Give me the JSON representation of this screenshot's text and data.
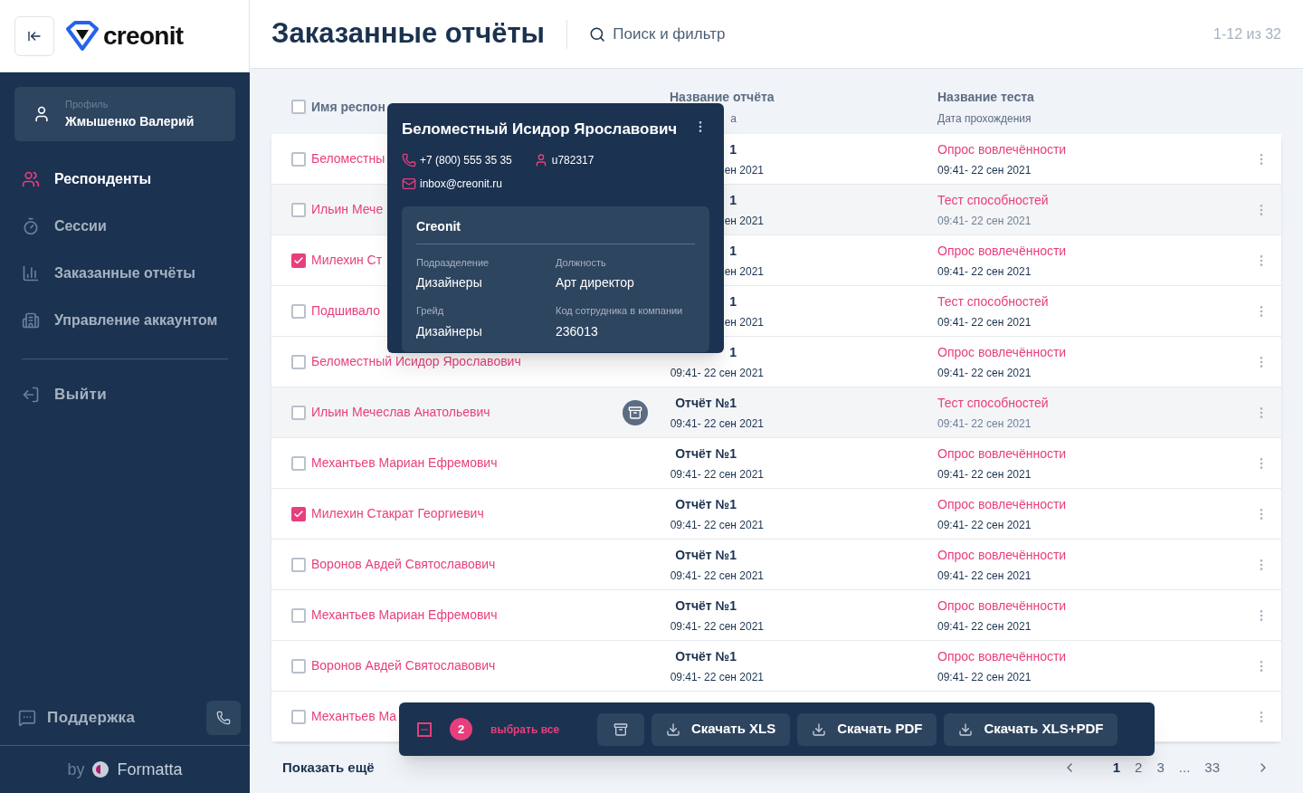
{
  "brand": {
    "name": "creonit"
  },
  "sidebar": {
    "profile": {
      "label": "Профиль",
      "name": "Жмышенко Валерий"
    },
    "items": [
      {
        "label": "Респонденты",
        "selected": true,
        "kind": "people"
      },
      {
        "label": "Сессии",
        "selected": false,
        "kind": "timer"
      },
      {
        "label": "Заказанные отчёты",
        "selected": false,
        "kind": "chart"
      },
      {
        "label": "Управление аккаунтом",
        "selected": false,
        "kind": "building"
      }
    ],
    "logout": "Выйти",
    "support": "Поддержка",
    "footer_by": "by",
    "footer_brand": "Formatta"
  },
  "header": {
    "title": "Заказанные отчёты",
    "search_placeholder": "Поиск и фильтр",
    "range": "1-12 из 32"
  },
  "table": {
    "select_all_checked": false,
    "columns": [
      {
        "title": "Имя респон"
      },
      {
        "title": "Название отчёта",
        "subtitle": "а"
      },
      {
        "title": "Название теста",
        "subtitle": "Дата прохождения"
      }
    ],
    "rows": [
      {
        "checked": false,
        "highlighted": false,
        "archive": false,
        "name": "Беломестны",
        "report": "1",
        "report_date": "ен 2021",
        "test": "Опрос вовлечённости",
        "test_date": "09:41- 22 сен 2021"
      },
      {
        "checked": false,
        "highlighted": true,
        "archive": false,
        "name": "Ильин Мече",
        "report": "1",
        "report_date": "ен 2021",
        "test": "Тест способностей",
        "test_date": "09:41- 22 сен 2021"
      },
      {
        "checked": true,
        "highlighted": false,
        "archive": false,
        "name": "Милехин Ст",
        "report": "1",
        "report_date": "ен 2021",
        "test": "Опрос вовлечённости",
        "test_date": "09:41- 22 сен 2021"
      },
      {
        "checked": false,
        "highlighted": false,
        "archive": false,
        "name": "Подшивало",
        "report": "1",
        "report_date": "ен 2021",
        "test": "Тест способностей",
        "test_date": "09:41- 22 сен 2021"
      },
      {
        "checked": false,
        "highlighted": false,
        "archive": false,
        "name": "Беломестный Исидор Ярославович",
        "report": "1",
        "report_date": "09:41- 22 сен 2021",
        "test": "Опрос вовлечённости",
        "test_date": "09:41- 22 сен 2021"
      },
      {
        "checked": false,
        "highlighted": true,
        "archive": true,
        "name": "Ильин Мечеслав Анатольевич",
        "report": "Отчёт №1",
        "report_date": "09:41- 22 сен 2021",
        "test": "Тест способностей",
        "test_date": "09:41- 22 сен 2021"
      },
      {
        "checked": false,
        "highlighted": false,
        "archive": false,
        "name": "Механтьев Мариан Ефремович",
        "report": "Отчёт №1",
        "report_date": "09:41- 22 сен 2021",
        "test": "Опрос вовлечённости",
        "test_date": "09:41- 22 сен 2021"
      },
      {
        "checked": true,
        "highlighted": false,
        "archive": false,
        "name": "Милехин Стакрат Георгиевич",
        "report": "Отчёт №1",
        "report_date": "09:41- 22 сен 2021",
        "test": "Опрос вовлечённости",
        "test_date": "09:41- 22 сен 2021"
      },
      {
        "checked": false,
        "highlighted": false,
        "archive": false,
        "name": "Воронов Авдей Святославович",
        "report": "Отчёт №1",
        "report_date": "09:41- 22 сен 2021",
        "test": "Опрос вовлечённости",
        "test_date": "09:41- 22 сен 2021"
      },
      {
        "checked": false,
        "highlighted": false,
        "archive": false,
        "name": "Механтьев Мариан Ефремович",
        "report": "Отчёт №1",
        "report_date": "09:41- 22 сен 2021",
        "test": "Опрос вовлечённости",
        "test_date": "09:41- 22 сен 2021"
      },
      {
        "checked": false,
        "highlighted": false,
        "archive": false,
        "name": "Воронов Авдей Святославович",
        "report": "Отчёт №1",
        "report_date": "09:41- 22 сен 2021",
        "test": "Опрос вовлечённости",
        "test_date": "09:41- 22 сен 2021"
      },
      {
        "checked": false,
        "archive": false,
        "name": "Механтьев Ма"
      }
    ]
  },
  "show_more": "Показать ещё",
  "pagination": {
    "pages": [
      {
        "label": "1",
        "selected": true
      },
      {
        "label": "2",
        "selected": false
      },
      {
        "label": "3",
        "selected": false
      },
      {
        "label": "...",
        "selected": false
      },
      {
        "label": "33",
        "selected": false
      }
    ]
  },
  "popup": {
    "name": "Беломестный Исидор Ярославович",
    "phone": "+7 (800) 555 35 35",
    "login": "u782317",
    "email": "inbox@creonit.ru",
    "company": "Creonit",
    "fields": [
      {
        "label": "Подразделение",
        "value": "Дизайнеры"
      },
      {
        "label": "Должность",
        "value": "Арт директор"
      },
      {
        "label": "Грейд",
        "value": "Дизайнеры"
      },
      {
        "label": "Код сотрудника в компании",
        "value": "236013"
      }
    ]
  },
  "action_bar": {
    "indeterminate": true,
    "count": "2",
    "select_all": "выбрать все",
    "buttons": [
      "Скачать XLS",
      "Скачать PDF",
      "Скачать XLS+PDF"
    ]
  }
}
